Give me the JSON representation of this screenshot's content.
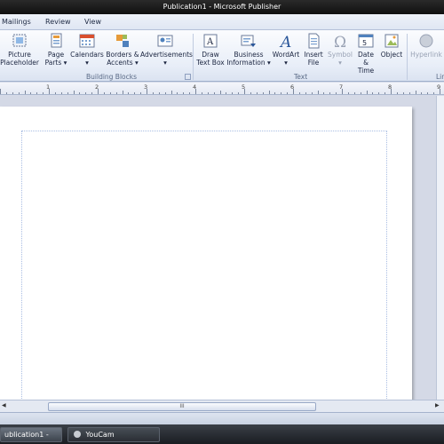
{
  "window": {
    "title": "Publication1  -  Microsoft Publisher"
  },
  "tabs": [
    "Mailings",
    "Review",
    "View"
  ],
  "ribbon": {
    "building_blocks": {
      "label": "Building Blocks",
      "buttons": [
        {
          "line1": "Picture",
          "line2": "Placeholder",
          "icon": "picture-placeholder-icon"
        },
        {
          "line1": "Page",
          "line2": "Parts ▾",
          "icon": "page-parts-icon"
        },
        {
          "line1": "Calendars",
          "line2": "▾",
          "icon": "calendar-icon"
        },
        {
          "line1": "Borders &",
          "line2": "Accents ▾",
          "icon": "borders-accents-icon"
        },
        {
          "line1": "Advertisements",
          "line2": "▾",
          "icon": "advertisement-icon"
        }
      ]
    },
    "text": {
      "label": "Text",
      "buttons": [
        {
          "line1": "Draw",
          "line2": "Text Box",
          "icon": "text-box-icon",
          "enabled": true
        },
        {
          "line1": "Business",
          "line2": "Information ▾",
          "icon": "business-info-icon",
          "enabled": true
        },
        {
          "line1": "WordArt",
          "line2": "▾",
          "icon": "wordart-icon",
          "enabled": true
        },
        {
          "line1": "Insert",
          "line2": "File",
          "icon": "insert-file-icon",
          "enabled": true
        },
        {
          "line1": "Symbol",
          "line2": "▾",
          "icon": "omega-icon",
          "enabled": false
        },
        {
          "line1": "Date",
          "line2": "& Time",
          "icon": "date-time-icon",
          "enabled": true
        },
        {
          "line1": "Object",
          "line2": "",
          "icon": "object-icon",
          "enabled": true
        }
      ]
    },
    "links": {
      "label": "Lin",
      "buttons": [
        {
          "line1": "Hyperlink",
          "line2": "",
          "icon": "hyperlink-icon",
          "enabled": false
        }
      ]
    }
  },
  "ruler": {
    "numbers": [
      "1",
      "2",
      "3",
      "4",
      "5",
      "6",
      "7",
      "8",
      "9"
    ]
  },
  "scrollbar": {
    "thumb_grip": "III"
  },
  "taskbar": {
    "items": [
      {
        "label": "ublication1 - Micr...",
        "active": true
      },
      {
        "label": "YouCam",
        "active": false
      }
    ]
  },
  "colors": {
    "accent": "#2b579a",
    "ribbon_bg": "#e8eef8",
    "workspace": "#d4d9e6",
    "taskbar": "#1a1d22"
  }
}
